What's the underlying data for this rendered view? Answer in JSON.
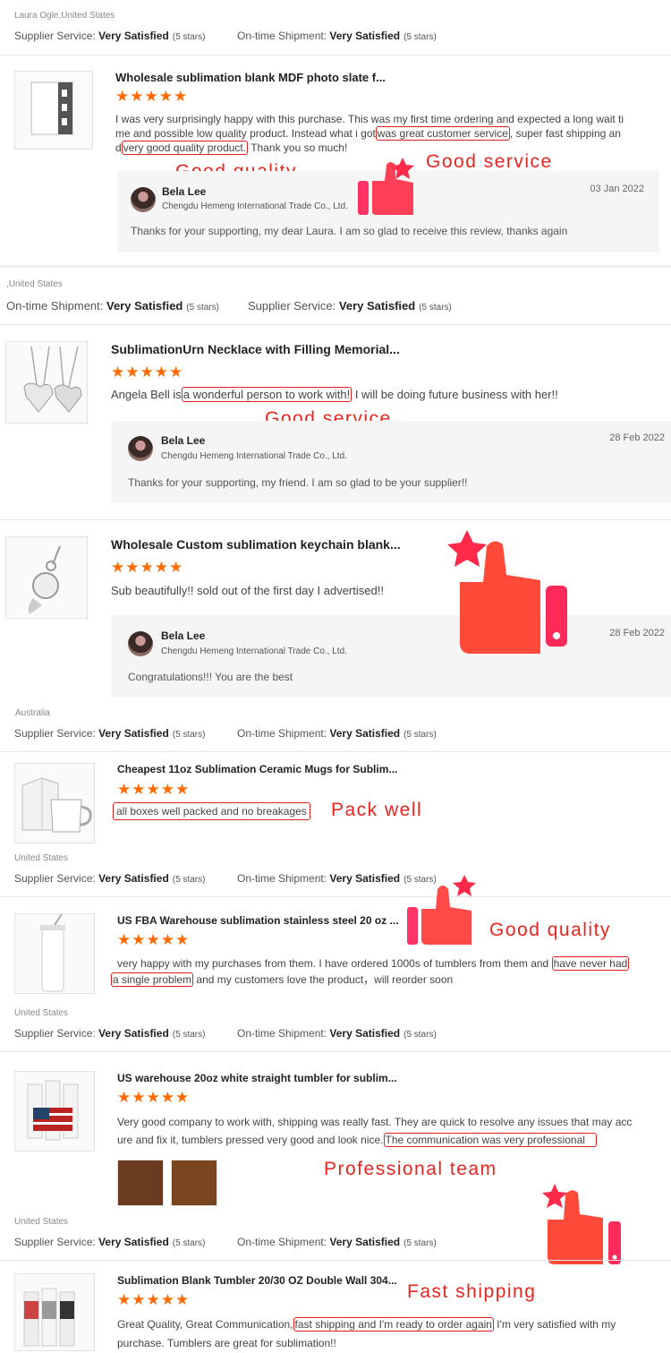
{
  "colors": {
    "accent_star": "#ff6a00",
    "callout": "#e8251f",
    "highlight_box": "#e02020"
  },
  "labels": {
    "supplier_service": "Supplier Service:",
    "ontime_shipment": "On-time Shipment:",
    "very_satisfied": "Very Satisfied",
    "five_stars": "(5 stars)"
  },
  "stars": "★★★★★",
  "reviews": [
    {
      "location": "Laura Ogle,United States",
      "title": "Wholesale sublimation blank MDF photo slate f...",
      "text_1": "I was very surprisingly happy with this purchase. This was my first time ordering and expected a long wait ti",
      "text_2a": "me and possible low quality product. Instead what i got",
      "hl_1": "was great customer service",
      "text_2b": ", super fast shipping an",
      "text_3a": "d",
      "hl_2": "very good quality product.",
      "text_3b": " Thank you so much!",
      "reply": {
        "name": "Bela Lee",
        "company": "Chengdu Hemeng International Trade Co., Ltd.",
        "date": "03 Jan 2022",
        "text": "Thanks for your supporting, my dear Laura. I am so glad to receive this review, thanks again"
      }
    },
    {
      "location": ",United States",
      "title": "SublimationUrn Necklace with Filling Memorial...",
      "text_a": "Angela Bell is",
      "hl": "a wonderful person to work with!",
      "text_b": " I will be doing future business with her!!",
      "reply": {
        "name": "Bela Lee",
        "company": "Chengdu Hemeng International Trade Co., Ltd.",
        "date": "28 Feb 2022",
        "text": "Thanks for your supporting, my friend. I am so glad to be your supplier!!"
      }
    },
    {
      "title": "Wholesale Custom sublimation keychain blank...",
      "text": "Sub beautifully!! sold out of the first day I advertised!!",
      "reply": {
        "name": "Bela Lee",
        "company": "Chengdu Hemeng International Trade Co., Ltd.",
        "date": "28 Feb 2022",
        "text": "Congratulations!!! You are the best"
      }
    },
    {
      "location": "Australia",
      "title": "Cheapest 11oz Sublimation Ceramic Mugs for Sublim...",
      "hl": "all boxes well packed and no breakages"
    },
    {
      "location": "United States",
      "title": "US FBA Warehouse sublimation stainless steel 20 oz ...",
      "text_1a": "very happy with my purchases from them. I have ordered 1000s of tumblers from them and",
      "hl_1": "have never had",
      "hl_2": "a single problem",
      "text_2b": " and my customers love the product，will reorder soon"
    },
    {
      "location": "United States",
      "title": "US warehouse 20oz white straight tumbler for sublim...",
      "text_1": "Very good company to work with, shipping was really fast. They are quick to resolve any issues that may acc",
      "text_2a": "ure and fix it, tumblers pressed very good and look nice.",
      "hl": "The communication was very professional"
    },
    {
      "location": "United States",
      "title": "Sublimation Blank Tumbler 20/30 OZ Double Wall 304...",
      "text_1a": "Great Quality, Great Communication,",
      "hl": "fast shipping and I'm ready to order again",
      "text_1b": " I'm very satisfied with my",
      "text_2": "purchase. Tumblers are great for sublimation!!"
    }
  ],
  "callouts": {
    "good_quality_1": "Good quality",
    "good_service_1": "Good service",
    "good_service_2": "Good service",
    "pack_well": "Pack well",
    "good_quality_2": "Good quality",
    "professional_team": "Professional team",
    "fast_shipping": "Fast shipping"
  }
}
